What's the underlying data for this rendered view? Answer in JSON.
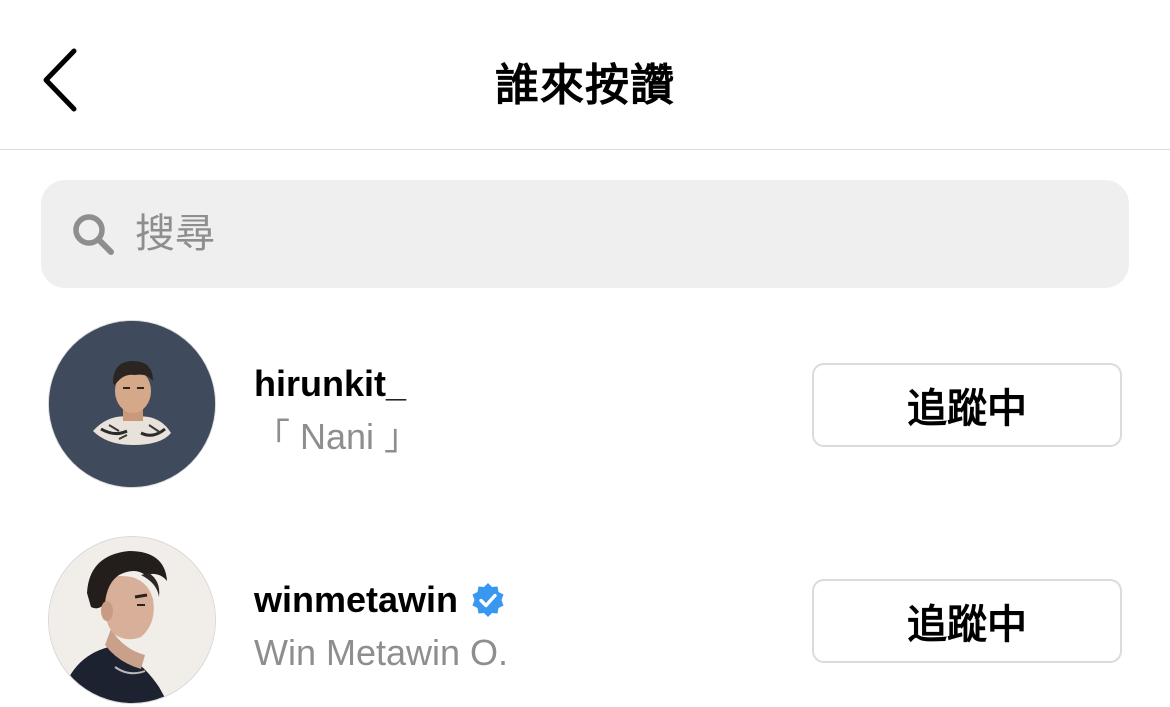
{
  "header": {
    "title": "誰來按讚",
    "back_icon": "chevron-left-icon"
  },
  "search": {
    "placeholder": "搜尋",
    "icon": "search-icon"
  },
  "users": [
    {
      "username": "hirunkit_",
      "full_name": "「 Nani 」",
      "verified": false,
      "button_label": "追蹤中"
    },
    {
      "username": "winmetawin",
      "full_name": "Win Metawin O.",
      "verified": true,
      "button_label": "追蹤中"
    }
  ],
  "colors": {
    "verified_badge": "#3897f0",
    "secondary_text": "#8e8e8e",
    "search_bg": "#efefef",
    "border": "#dbdbdb",
    "avatar1_bg": "#3f4b5c"
  }
}
